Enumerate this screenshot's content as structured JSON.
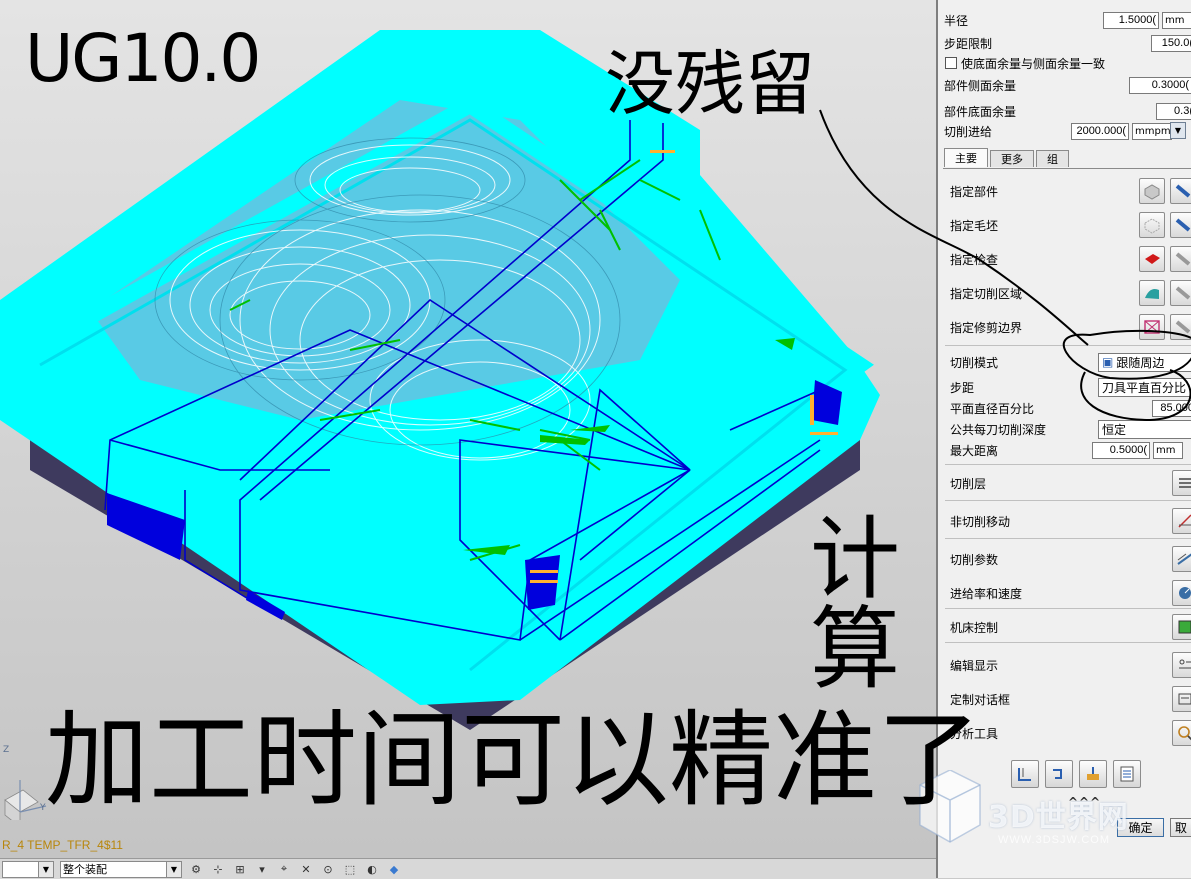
{
  "viewport": {
    "part_label": "R_4   TEMP_TFR_4$11",
    "triad": {
      "z": "Z",
      "y": "Y"
    }
  },
  "statusbar": {
    "combo1_value": "",
    "combo2_value": "整个装配"
  },
  "dialog": {
    "rows": {
      "radius": {
        "label": "半径",
        "value": "1.5000(",
        "unit": "mm"
      },
      "stepover_limit": {
        "label": "步距限制",
        "value": "150.0("
      },
      "floor_wall_same": {
        "label": "使底面余量与侧面余量一致"
      },
      "part_wall_stock": {
        "label": "部件侧面余量",
        "value": "0.3000("
      },
      "part_floor_stock": {
        "label": "部件底面余量",
        "value": "0.3("
      },
      "cut_feed": {
        "label": "切削进给",
        "value": "2000.000(",
        "unit": "mmpm"
      }
    },
    "tabs": [
      {
        "label": "主要"
      },
      {
        "label": "更多"
      },
      {
        "label": "组"
      }
    ],
    "geometry": [
      {
        "label": "指定部件"
      },
      {
        "label": "指定毛坯"
      },
      {
        "label": "指定检查"
      },
      {
        "label": "指定切削区域"
      },
      {
        "label": "指定修剪边界"
      }
    ],
    "cut_pattern": {
      "label": "切削模式",
      "value": "跟随周边"
    },
    "stepover": {
      "label": "步距",
      "value": "刀具平直百分比"
    },
    "flat_diameter_pct": {
      "label": "平面直径百分比",
      "value": "85.000"
    },
    "depth_per_cut": {
      "label": "公共每刀切削深度",
      "value": "恒定"
    },
    "max_distance": {
      "label": "最大距离",
      "value": "0.5000(",
      "unit": "mm"
    },
    "sections": [
      {
        "label": "切削层"
      },
      {
        "label": "非切削移动"
      },
      {
        "label": "切削参数"
      },
      {
        "label": "进给率和速度"
      },
      {
        "label": "机床控制"
      },
      {
        "label": "编辑显示"
      },
      {
        "label": "定制对话框"
      },
      {
        "label": "分析工具"
      }
    ],
    "collapse_label": "^^^",
    "ok_label": "确定",
    "cancel_label": "取"
  },
  "handwriting": {
    "version": "UG10.0",
    "no_leftover": "没残留",
    "compute": "计算",
    "machining_time": "加工时间可以精准了"
  },
  "watermark": {
    "text": "3D世界网",
    "url": "WWW.3DSJW.COM"
  },
  "colors": {
    "toolpath_cyan": "#00ffff",
    "toolpath_blue": "#0000cc",
    "toolpath_green": "#00c000",
    "part_top": "#a7a0cc",
    "part_side": "#3e3a5e"
  }
}
